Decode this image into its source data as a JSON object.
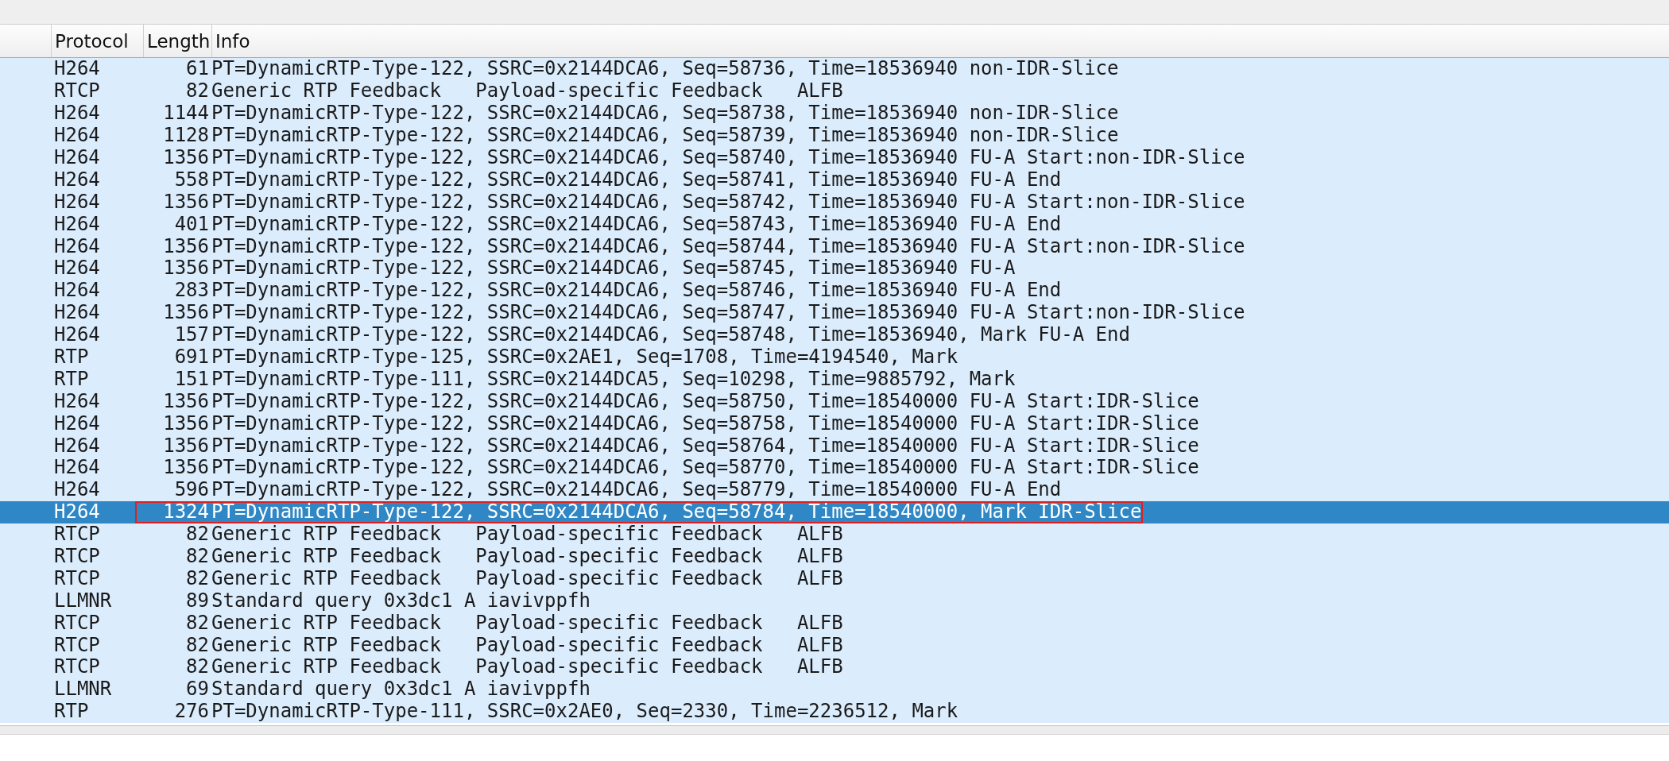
{
  "table": {
    "columns": [
      "Protocol",
      "Length",
      "Info"
    ],
    "rows": [
      {
        "protocol": "H264",
        "length": "61",
        "info": "PT=DynamicRTP-Type-122, SSRC=0x2144DCA6, Seq=58736, Time=18536940 non-IDR-Slice",
        "selected": false,
        "outlined": false
      },
      {
        "protocol": "RTCP",
        "length": "82",
        "info": "Generic RTP Feedback   Payload-specific Feedback   ALFB",
        "selected": false,
        "outlined": false
      },
      {
        "protocol": "H264",
        "length": "1144",
        "info": "PT=DynamicRTP-Type-122, SSRC=0x2144DCA6, Seq=58738, Time=18536940 non-IDR-Slice",
        "selected": false,
        "outlined": false
      },
      {
        "protocol": "H264",
        "length": "1128",
        "info": "PT=DynamicRTP-Type-122, SSRC=0x2144DCA6, Seq=58739, Time=18536940 non-IDR-Slice",
        "selected": false,
        "outlined": false
      },
      {
        "protocol": "H264",
        "length": "1356",
        "info": "PT=DynamicRTP-Type-122, SSRC=0x2144DCA6, Seq=58740, Time=18536940 FU-A Start:non-IDR-Slice",
        "selected": false,
        "outlined": false
      },
      {
        "protocol": "H264",
        "length": "558",
        "info": "PT=DynamicRTP-Type-122, SSRC=0x2144DCA6, Seq=58741, Time=18536940 FU-A End",
        "selected": false,
        "outlined": false
      },
      {
        "protocol": "H264",
        "length": "1356",
        "info": "PT=DynamicRTP-Type-122, SSRC=0x2144DCA6, Seq=58742, Time=18536940 FU-A Start:non-IDR-Slice",
        "selected": false,
        "outlined": false
      },
      {
        "protocol": "H264",
        "length": "401",
        "info": "PT=DynamicRTP-Type-122, SSRC=0x2144DCA6, Seq=58743, Time=18536940 FU-A End",
        "selected": false,
        "outlined": false
      },
      {
        "protocol": "H264",
        "length": "1356",
        "info": "PT=DynamicRTP-Type-122, SSRC=0x2144DCA6, Seq=58744, Time=18536940 FU-A Start:non-IDR-Slice",
        "selected": false,
        "outlined": false
      },
      {
        "protocol": "H264",
        "length": "1356",
        "info": "PT=DynamicRTP-Type-122, SSRC=0x2144DCA6, Seq=58745, Time=18536940 FU-A",
        "selected": false,
        "outlined": false
      },
      {
        "protocol": "H264",
        "length": "283",
        "info": "PT=DynamicRTP-Type-122, SSRC=0x2144DCA6, Seq=58746, Time=18536940 FU-A End",
        "selected": false,
        "outlined": false
      },
      {
        "protocol": "H264",
        "length": "1356",
        "info": "PT=DynamicRTP-Type-122, SSRC=0x2144DCA6, Seq=58747, Time=18536940 FU-A Start:non-IDR-Slice",
        "selected": false,
        "outlined": false
      },
      {
        "protocol": "H264",
        "length": "157",
        "info": "PT=DynamicRTP-Type-122, SSRC=0x2144DCA6, Seq=58748, Time=18536940, Mark FU-A End",
        "selected": false,
        "outlined": false
      },
      {
        "protocol": "RTP",
        "length": "691",
        "info": "PT=DynamicRTP-Type-125, SSRC=0x2AE1, Seq=1708, Time=4194540, Mark",
        "selected": false,
        "outlined": false
      },
      {
        "protocol": "RTP",
        "length": "151",
        "info": "PT=DynamicRTP-Type-111, SSRC=0x2144DCA5, Seq=10298, Time=9885792, Mark",
        "selected": false,
        "outlined": false
      },
      {
        "protocol": "H264",
        "length": "1356",
        "info": "PT=DynamicRTP-Type-122, SSRC=0x2144DCA6, Seq=58750, Time=18540000 FU-A Start:IDR-Slice",
        "selected": false,
        "outlined": false
      },
      {
        "protocol": "H264",
        "length": "1356",
        "info": "PT=DynamicRTP-Type-122, SSRC=0x2144DCA6, Seq=58758, Time=18540000 FU-A Start:IDR-Slice",
        "selected": false,
        "outlined": false
      },
      {
        "protocol": "H264",
        "length": "1356",
        "info": "PT=DynamicRTP-Type-122, SSRC=0x2144DCA6, Seq=58764, Time=18540000 FU-A Start:IDR-Slice",
        "selected": false,
        "outlined": false
      },
      {
        "protocol": "H264",
        "length": "1356",
        "info": "PT=DynamicRTP-Type-122, SSRC=0x2144DCA6, Seq=58770, Time=18540000 FU-A Start:IDR-Slice",
        "selected": false,
        "outlined": false
      },
      {
        "protocol": "H264",
        "length": "596",
        "info": "PT=DynamicRTP-Type-122, SSRC=0x2144DCA6, Seq=58779, Time=18540000 FU-A End",
        "selected": false,
        "outlined": false
      },
      {
        "protocol": "H264",
        "length": "1324",
        "info": "PT=DynamicRTP-Type-122, SSRC=0x2144DCA6, Seq=58784, Time=18540000, Mark IDR-Slice",
        "selected": true,
        "outlined": true
      },
      {
        "protocol": "RTCP",
        "length": "82",
        "info": "Generic RTP Feedback   Payload-specific Feedback   ALFB",
        "selected": false,
        "outlined": false
      },
      {
        "protocol": "RTCP",
        "length": "82",
        "info": "Generic RTP Feedback   Payload-specific Feedback   ALFB",
        "selected": false,
        "outlined": false
      },
      {
        "protocol": "RTCP",
        "length": "82",
        "info": "Generic RTP Feedback   Payload-specific Feedback   ALFB",
        "selected": false,
        "outlined": false
      },
      {
        "protocol": "LLMNR",
        "length": "89",
        "info": "Standard query 0x3dc1 A iavivppfh",
        "selected": false,
        "outlined": false
      },
      {
        "protocol": "RTCP",
        "length": "82",
        "info": "Generic RTP Feedback   Payload-specific Feedback   ALFB",
        "selected": false,
        "outlined": false
      },
      {
        "protocol": "RTCP",
        "length": "82",
        "info": "Generic RTP Feedback   Payload-specific Feedback   ALFB",
        "selected": false,
        "outlined": false
      },
      {
        "protocol": "RTCP",
        "length": "82",
        "info": "Generic RTP Feedback   Payload-specific Feedback   ALFB",
        "selected": false,
        "outlined": false
      },
      {
        "protocol": "LLMNR",
        "length": "69",
        "info": "Standard query 0x3dc1 A iavivppfh",
        "selected": false,
        "outlined": false
      },
      {
        "protocol": "RTP",
        "length": "276",
        "info": "PT=DynamicRTP-Type-111, SSRC=0x2AE0, Seq=2330, Time=2236512, Mark",
        "selected": false,
        "outlined": false
      }
    ]
  }
}
